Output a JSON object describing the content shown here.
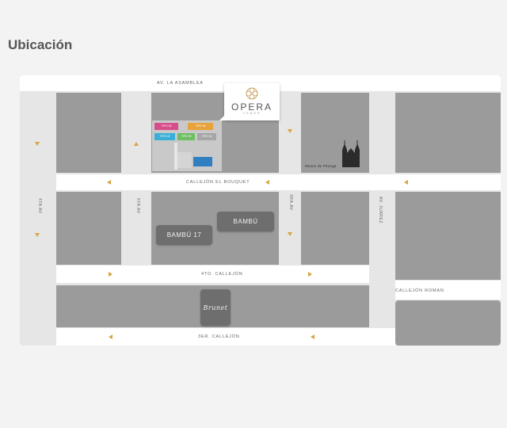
{
  "page": {
    "title": "Ubicación"
  },
  "map": {
    "streets": {
      "top": "AV. LA ASAMBLEA",
      "callejon_bouquet": "CALLEJÓN EL BOUQUET",
      "cuarto_callejon": "4TO. CALLEJÓN",
      "tercer_callejon": "3ER. CALLEJÓN",
      "callejon_roman": "CALLEJÓN ROMAN",
      "av4ta": "4TA AV",
      "av5ta": "5TA AV",
      "av3ra": "3RA AV",
      "juarez": "AV. JUÁREZ"
    },
    "landmarks": {
      "opera_name": "OPERA",
      "opera_sub": "TOWER",
      "museum": "Museo de Pitunga",
      "bambu_17": "BAMBÚ 17",
      "bambu": "BAMBÚ",
      "brunet": "Brunet"
    },
    "units": [
      {
        "label": "TIPO 03",
        "color": "#d64d8a"
      },
      {
        "label": "TIPO 05",
        "color": "#e8a23a"
      },
      {
        "label": "TIPO 02",
        "color": "#3aaed8"
      },
      {
        "label": "TIPO 03",
        "color": "#6fbe63"
      },
      {
        "label": "TIPO 04",
        "color": "#a6a6a6"
      }
    ],
    "colors": {
      "block": "#9b9b9b",
      "street": "#ffffff",
      "arrow": "#d9a441"
    }
  }
}
